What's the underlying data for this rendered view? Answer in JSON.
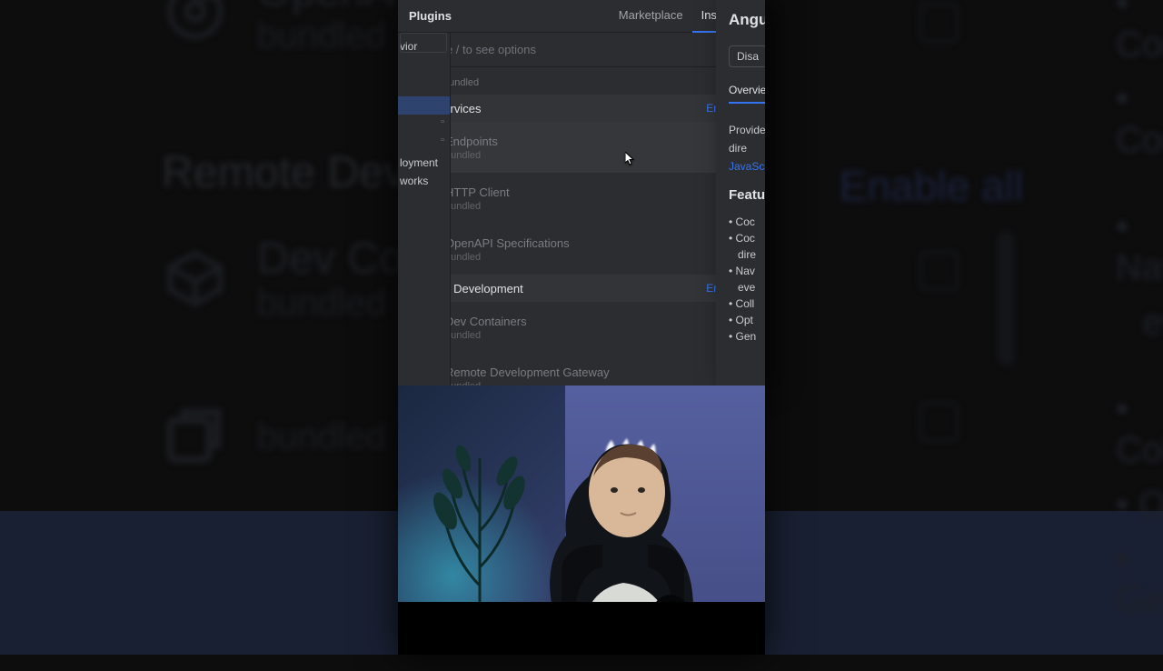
{
  "header": {
    "title": "Plugins",
    "tabs": {
      "marketplace": "Marketplace",
      "installed": "Installed"
    }
  },
  "search": {
    "placeholder": "Type / to see options"
  },
  "prev_bundled": "bundled",
  "sections": [
    {
      "title": "Microservices",
      "enable": "Enable all",
      "items": [
        {
          "name": "Endpoints",
          "sub": "bundled",
          "icon": "endpoints"
        },
        {
          "name": "HTTP Client",
          "sub": "bundled",
          "icon": "http"
        },
        {
          "name": "OpenAPI Specifications",
          "sub": "bundled",
          "icon": "openapi"
        }
      ]
    },
    {
      "title": "Remote Development",
      "enable": "Enable all",
      "items": [
        {
          "name": "Dev Containers",
          "sub": "bundled",
          "icon": "devc"
        },
        {
          "name": "Remote Development Gateway",
          "sub": "bundled",
          "icon": "remote"
        }
      ]
    }
  ],
  "sidebar": {
    "items": [
      "vior",
      "",
      "",
      "",
      "",
      "",
      "loyment",
      "works"
    ]
  },
  "detail": {
    "title": "Angu",
    "disable": "Disa",
    "overview": "Overview",
    "provides": "Provide",
    "dire": "dire",
    "js": "JavaSc",
    "feat": "Featu",
    "bullets": [
      "Coc",
      "Coc",
      "dire",
      "Nav",
      "eve",
      "Coll",
      "Opt",
      "Gen"
    ]
  },
  "bg": {
    "openapi": "OpenA",
    "bundled": "bundled",
    "remote": "Remote Devel",
    "devc": "Dev Co",
    "enable": "Enable all",
    "r": [
      "Coc",
      "Coc",
      "Nav",
      "eve",
      "Coll",
      "Opt",
      "Gen"
    ]
  }
}
